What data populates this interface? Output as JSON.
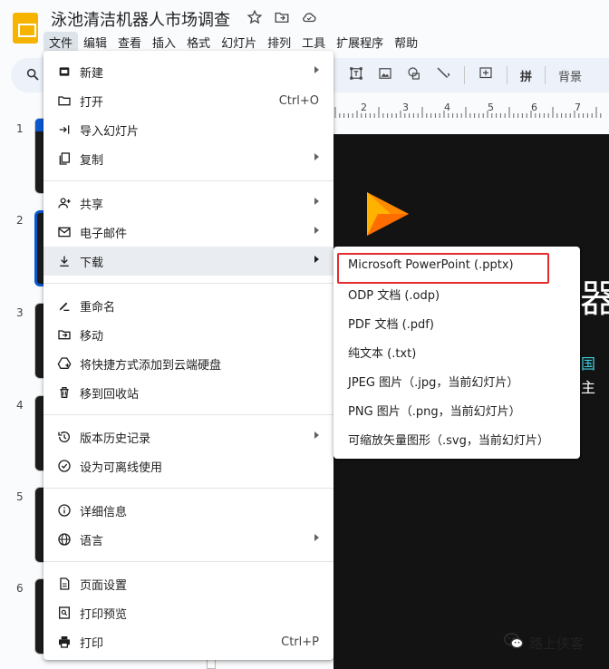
{
  "app": {
    "title": "泳池清洁机器人市场调查"
  },
  "menubar": [
    {
      "label": "文件",
      "active": true
    },
    {
      "label": "编辑"
    },
    {
      "label": "查看"
    },
    {
      "label": "插入"
    },
    {
      "label": "格式"
    },
    {
      "label": "幻灯片"
    },
    {
      "label": "排列"
    },
    {
      "label": "工具"
    },
    {
      "label": "扩展程序"
    },
    {
      "label": "帮助"
    }
  ],
  "toolbar": {
    "format_label": "拼",
    "background_label": "背景"
  },
  "ruler": {
    "labels": [
      "2",
      "3",
      "4",
      "5",
      "6",
      "7"
    ]
  },
  "slides": {
    "numbers": [
      "1",
      "2",
      "3",
      "4",
      "5",
      "6"
    ],
    "selected": "2"
  },
  "file_menu": {
    "items": [
      {
        "label": "新建",
        "icon": "new-slides-icon",
        "submenu": true
      },
      {
        "label": "打开",
        "icon": "folder-icon",
        "shortcut": "Ctrl+O"
      },
      {
        "label": "导入幻灯片",
        "icon": "import-icon"
      },
      {
        "label": "复制",
        "icon": "copy-icon",
        "submenu": true
      },
      {
        "label": "共享",
        "icon": "person-add-icon",
        "submenu": true
      },
      {
        "label": "电子邮件",
        "icon": "mail-icon",
        "submenu": true
      },
      {
        "label": "下载",
        "icon": "download-icon",
        "submenu": true,
        "hover": true
      },
      {
        "label": "重命名",
        "icon": "rename-icon"
      },
      {
        "label": "移动",
        "icon": "move-icon"
      },
      {
        "label": "将快捷方式添加到云端硬盘",
        "icon": "drive-shortcut-icon"
      },
      {
        "label": "移到回收站",
        "icon": "trash-icon"
      },
      {
        "label": "版本历史记录",
        "icon": "history-icon",
        "submenu": true
      },
      {
        "label": "设为可离线使用",
        "icon": "offline-icon"
      },
      {
        "label": "详细信息",
        "icon": "info-icon"
      },
      {
        "label": "语言",
        "icon": "globe-icon",
        "submenu": true
      },
      {
        "label": "页面设置",
        "icon": "page-setup-icon"
      },
      {
        "label": "打印预览",
        "icon": "print-preview-icon"
      },
      {
        "label": "打印",
        "icon": "print-icon",
        "shortcut": "Ctrl+P"
      }
    ]
  },
  "download_submenu": {
    "items": [
      {
        "label": "Microsoft PowerPoint (.pptx)",
        "highlighted": true
      },
      {
        "label": "ODP 文档 (.odp)"
      },
      {
        "label": "PDF 文档 (.pdf)"
      },
      {
        "label": "纯文本 (.txt)"
      },
      {
        "label": "JPEG 图片（.jpg，当前幻灯片）"
      },
      {
        "label": "PNG 图片（.png，当前幻灯片）"
      },
      {
        "label": "可缩放矢量图形（.svg，当前幻灯片）"
      }
    ]
  },
  "canvas": {
    "big_char": "器",
    "side_chars": [
      "国",
      "主"
    ]
  },
  "watermark": {
    "text": "路上侠客"
  },
  "colors": {
    "accent_blue": "#0b57d0",
    "highlight_red": "#e52d2d",
    "logo_yellow": "#f6b400",
    "play_orange": "#ff8a00"
  }
}
